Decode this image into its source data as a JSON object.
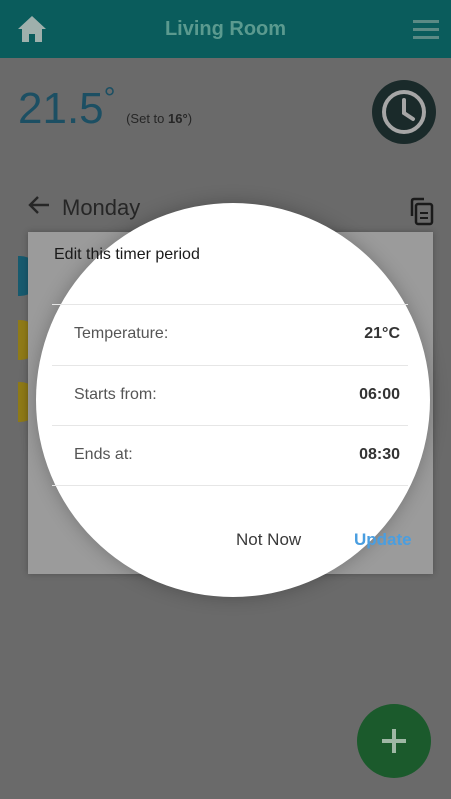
{
  "appbar": {
    "title": "Living Room"
  },
  "status": {
    "current_temp": "21.5",
    "degree": "°",
    "set_to_prefix": "(Set to ",
    "set_to_value": "16°",
    "set_to_suffix": ")"
  },
  "schedule": {
    "day": "Monday"
  },
  "dialog": {
    "title": "Edit this timer period",
    "fields": [
      {
        "label": "Temperature:",
        "value": "21°C"
      },
      {
        "label": "Starts from:",
        "value": "06:00"
      },
      {
        "label": "Ends at:",
        "value": "08:30"
      }
    ],
    "not_now_label": "Not Now",
    "update_label": "Update"
  },
  "colors": {
    "accent": "#4a9ee0",
    "appbar": "#0a5c5c"
  }
}
